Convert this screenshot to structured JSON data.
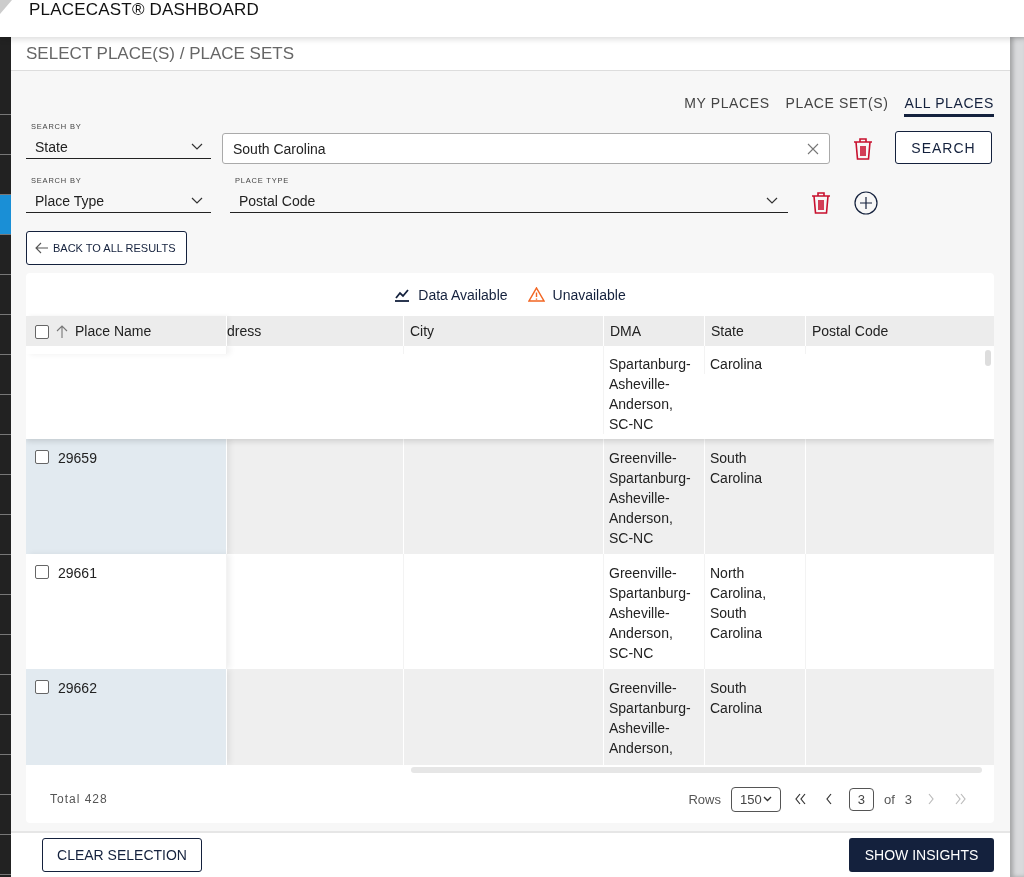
{
  "header": {
    "title": "PLACECAST® DASHBOARD"
  },
  "sidebar": {
    "items": [
      {
        "selected": false
      },
      {
        "selected": false
      },
      {
        "selected": false
      },
      {
        "selected": true
      },
      {
        "selected": false
      },
      {
        "selected": false
      },
      {
        "selected": false
      },
      {
        "selected": false
      },
      {
        "selected": false
      },
      {
        "selected": false
      },
      {
        "selected": false
      },
      {
        "selected": false
      },
      {
        "selected": false
      },
      {
        "selected": false
      },
      {
        "selected": false
      },
      {
        "selected": false
      },
      {
        "selected": false
      },
      {
        "selected": false
      },
      {
        "selected": false
      },
      {
        "selected": false
      }
    ]
  },
  "dialog": {
    "title": "SELECT PLACE(S) / PLACE SETS",
    "tabs": [
      {
        "label": "MY PLACES",
        "selected": false
      },
      {
        "label": "PLACE SET(S)",
        "selected": false
      },
      {
        "label": "ALL PLACES",
        "selected": true
      }
    ],
    "filters": [
      {
        "kind": "text",
        "label": "SEARCH BY",
        "value": "State",
        "query": "South Carolina"
      },
      {
        "kind": "select",
        "label": "SEARCH BY",
        "value": "Place Type",
        "field_label": "PLACE TYPE",
        "field_value": "Postal Code"
      }
    ],
    "search_button": "SEARCH",
    "back_button": "BACK TO ALL RESULTS",
    "legend": [
      {
        "kind": "available",
        "label": "Data Available"
      },
      {
        "kind": "unavailable",
        "label": "Unavailable"
      }
    ],
    "table": {
      "select_all_checked": false,
      "columns": [
        {
          "label": "Place Name"
        },
        {
          "label": "dress"
        },
        {
          "label": "City"
        },
        {
          "label": "DMA"
        },
        {
          "label": "State"
        },
        {
          "label": "Postal Code"
        }
      ],
      "rows": [
        {
          "dma": "Spartanburg-Asheville-Anderson, SC-NC",
          "state": "Carolina"
        },
        {
          "checked": false,
          "place_name": "29659",
          "dma": "Greenville-Spartanburg-Asheville-Anderson, SC-NC",
          "state": "South Carolina"
        },
        {
          "checked": false,
          "place_name": "29661",
          "dma": "Greenville-Spartanburg-Asheville-Anderson, SC-NC",
          "state": "North Carolina, South Carolina"
        },
        {
          "checked": false,
          "place_name": "29662",
          "dma": "Greenville-Spartanburg-Asheville-Anderson,",
          "state": "South Carolina"
        }
      ]
    },
    "pagination": {
      "total": "Total 428",
      "rows_label": "Rows",
      "rows_per_page": "150",
      "page": "3",
      "of_label": "of",
      "page_count": "3",
      "buttons": [
        {
          "kind": "first",
          "disabled": false
        },
        {
          "kind": "prev",
          "disabled": false
        },
        {
          "kind": "next",
          "disabled": true
        },
        {
          "kind": "last",
          "disabled": true
        }
      ]
    },
    "clear_button": "CLEAR SELECTION",
    "insights_button": "SHOW INSIGHTS"
  }
}
